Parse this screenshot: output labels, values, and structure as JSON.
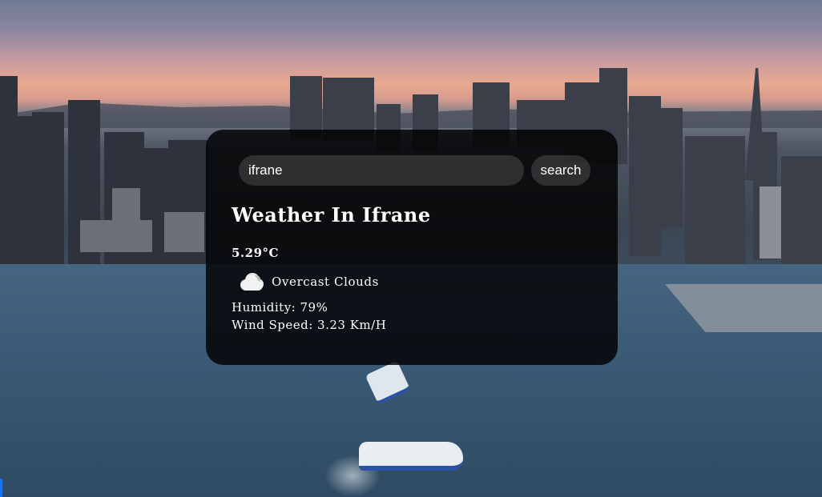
{
  "search": {
    "value": "ifrane",
    "button_label": "search"
  },
  "weather": {
    "title": "Weather In Ifrane",
    "temperature": "5.29°C",
    "icon": "cloud-icon",
    "description": "Overcast Clouds",
    "humidity": "Humidity: 79%",
    "wind": "Wind Speed: 3.23 Km/H"
  },
  "colors": {
    "card_background": "#000000",
    "text": "#ffffff",
    "input_background": "#7d7d7d"
  }
}
